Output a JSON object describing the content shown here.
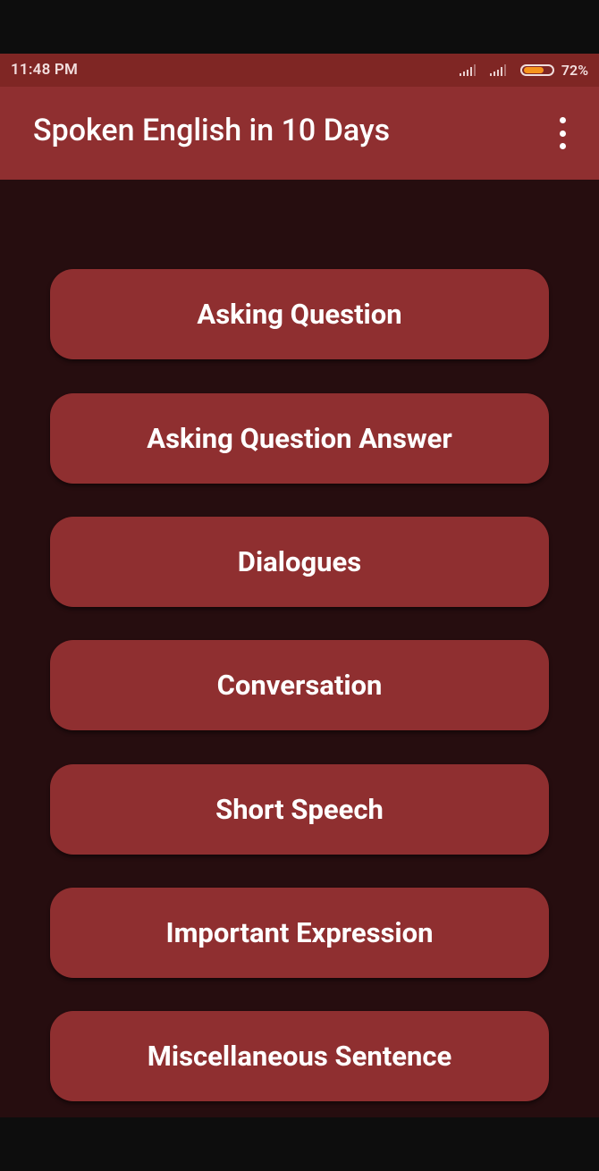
{
  "status_bar": {
    "time": "11:48 PM",
    "battery_percent": "72%",
    "battery_level": 0.72,
    "battery_color": "#f7941d"
  },
  "app_bar": {
    "title": "Spoken English in 10 Days",
    "overflow_icon": "more-vert-icon"
  },
  "menu": {
    "items": [
      {
        "label": "Asking Question"
      },
      {
        "label": "Asking Question Answer"
      },
      {
        "label": "Dialogues"
      },
      {
        "label": "Conversation"
      },
      {
        "label": "Short Speech"
      },
      {
        "label": "Important Expression"
      },
      {
        "label": "Miscellaneous Sentence"
      }
    ]
  },
  "colors": {
    "status_bar": "#7f2624",
    "app_bar": "#8f2f30",
    "background": "#260d0f",
    "button": "#8f2f30",
    "button_text": "#ffffff"
  }
}
